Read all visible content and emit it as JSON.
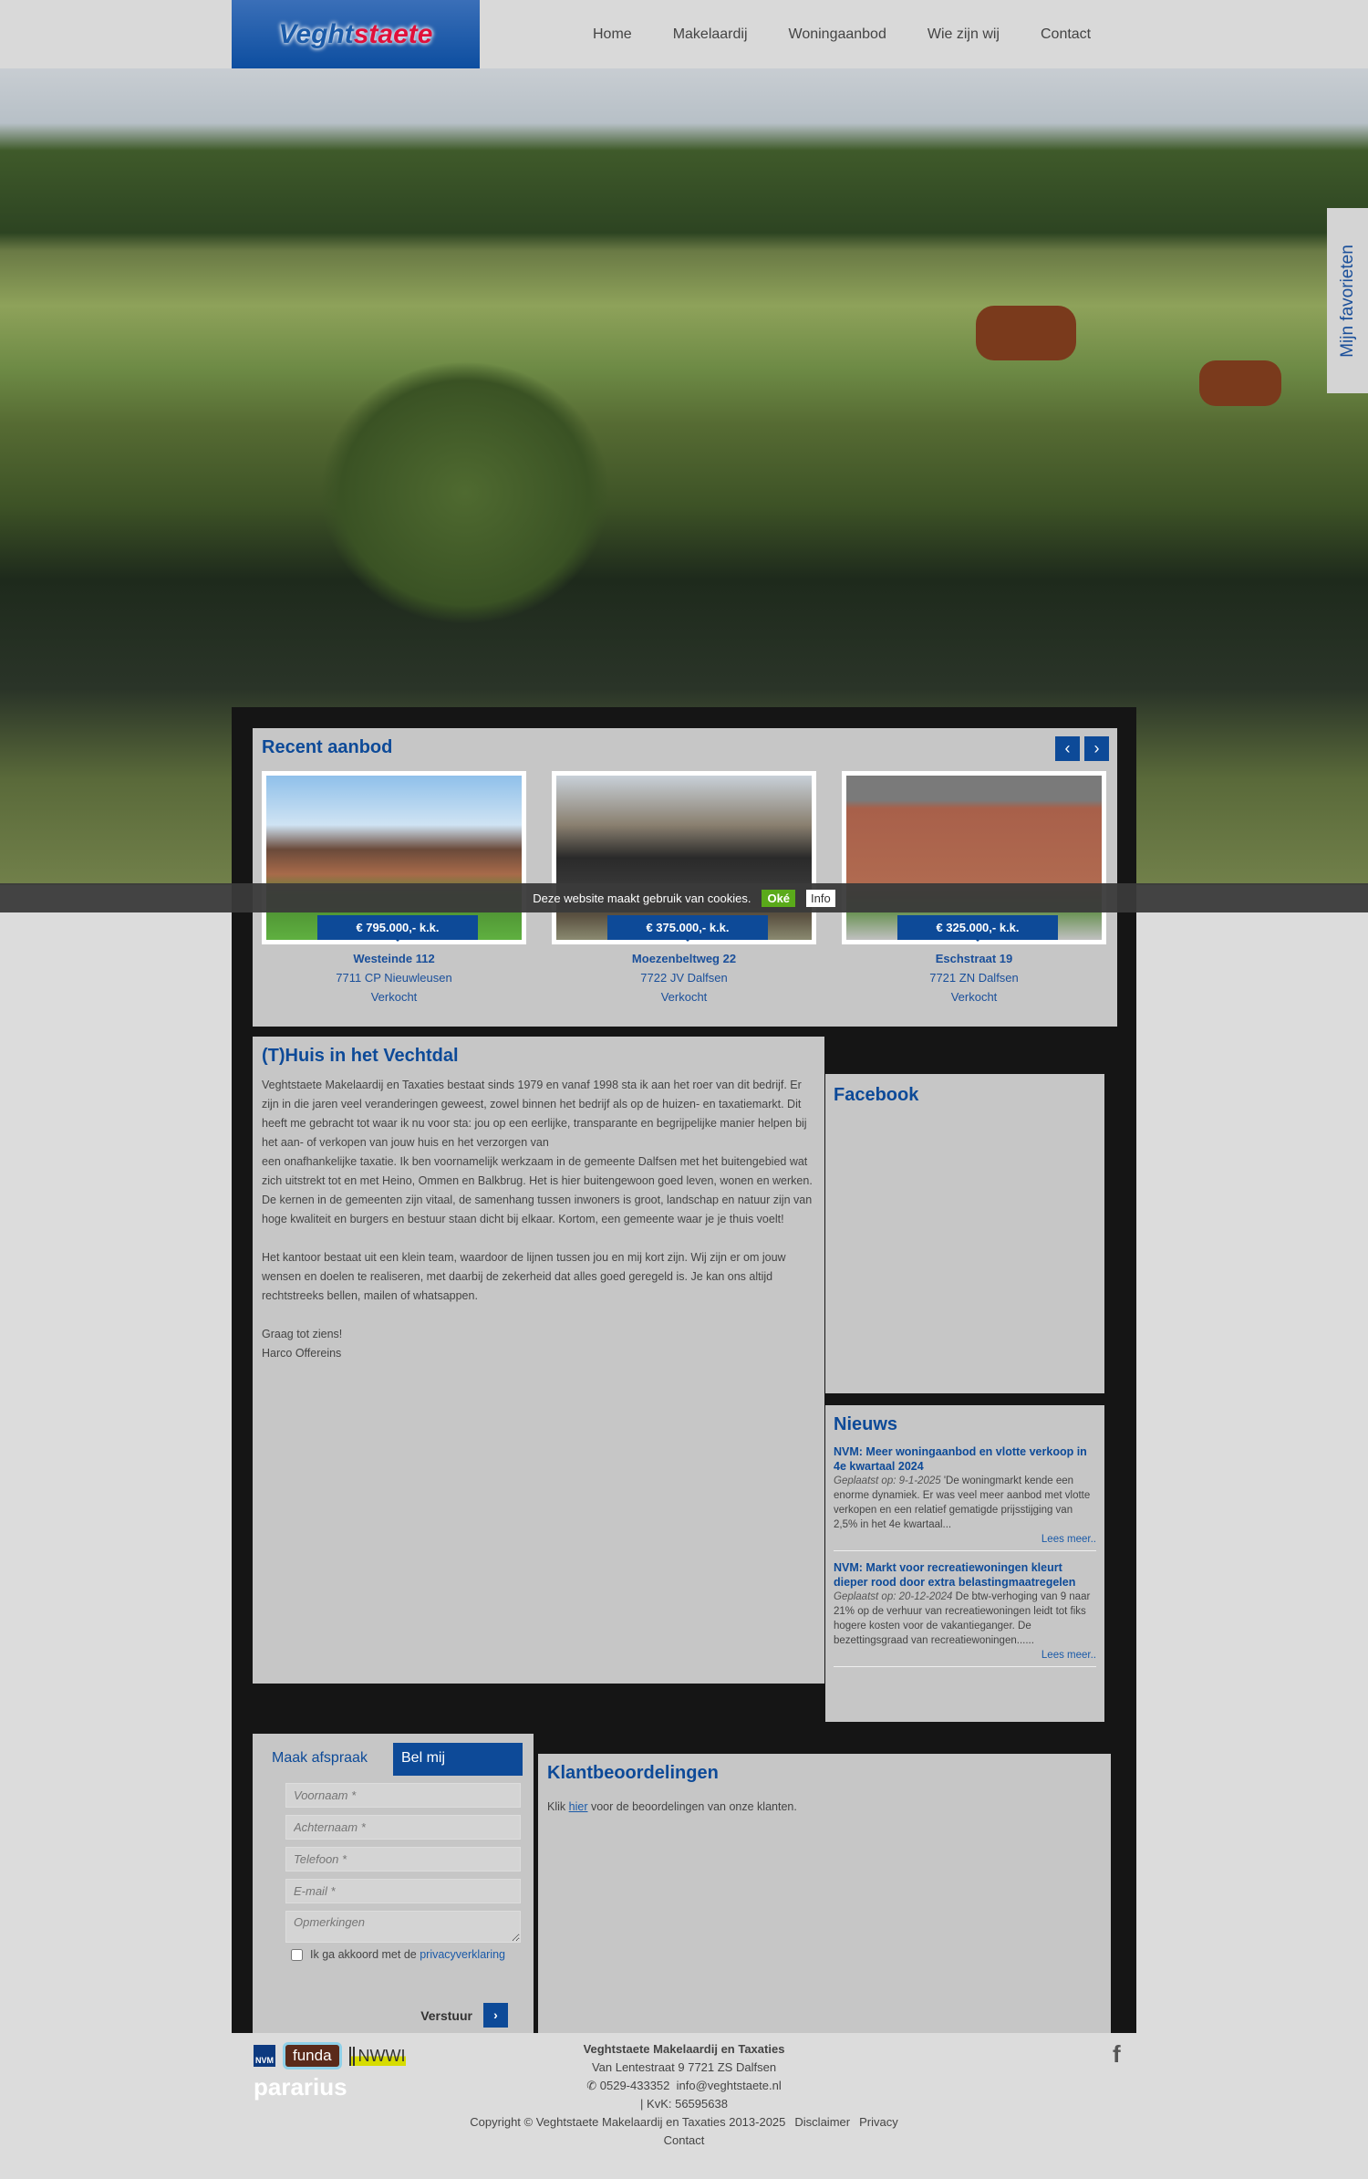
{
  "header": {
    "logo_main": "Veght",
    "logo_accent": "staete",
    "nav": [
      "Home",
      "Makelaardij",
      "Woningaanbod",
      "Wie zijn wij",
      "Contact"
    ]
  },
  "favorites_tab": "Mijn favorieten",
  "cookie": {
    "text": "Deze website maakt gebruik van cookies.",
    "ok": "Oké",
    "info": "Info"
  },
  "recent": {
    "title": "Recent aanbod",
    "prev": "‹",
    "next": "›",
    "items": [
      {
        "price": "€ 795.000,- k.k.",
        "street": "Westeinde 112",
        "city": "7711 CP Nieuwleusen",
        "status": "Verkocht"
      },
      {
        "price": "€ 375.000,- k.k.",
        "street": "Moezenbeltweg 22",
        "city": "7722 JV Dalfsen",
        "status": "Verkocht"
      },
      {
        "price": "€ 325.000,- k.k.",
        "street": "Eschstraat 19",
        "city": "7721 ZN Dalfsen",
        "status": "Verkocht"
      }
    ]
  },
  "main": {
    "title": "(T)Huis in het Vechtdal",
    "paragraphs": [
      "Veghtstaete Makelaardij en Taxaties bestaat sinds 1979 en vanaf 1998 sta ik aan het roer van dit bedrijf. Er zijn in die jaren veel veranderingen geweest, zowel binnen het bedrijf als op de huizen- en taxatiemarkt. Dit heeft me gebracht tot waar ik nu voor sta: jou op een eerlijke, transparante en begrijpelijke manier helpen bij het aan- of verkopen van jouw huis en het verzorgen van\neen onafhankelijke taxatie. Ik ben voornamelijk werkzaam in de gemeente Dalfsen met het buitengebied wat zich uitstrekt tot en met Heino, Ommen en Balkbrug. Het  is hier buitengewoon goed leven, wonen en werken. De kernen in de gemeenten zijn vitaal, de samenhang tussen inwoners is groot, landschap en natuur zijn van hoge kwaliteit en burgers en bestuur staan dicht bij elkaar. Kortom, een gemeente waar je je thuis voelt!",
      "Het kantoor bestaat uit een klein team, waardoor de lijnen tussen jou en mij kort zijn. Wij zijn er om jouw wensen en doelen te realiseren, met daarbij de zekerheid dat alles goed geregeld is. Je kan ons altijd rechtstreeks bellen, mailen of whatsappen.",
      "Graag tot ziens!\nHarco Offereins"
    ]
  },
  "facebook": {
    "title": "Facebook"
  },
  "news": {
    "title": "Nieuws",
    "items": [
      {
        "title": "NVM: Meer woningaanbod en vlotte verkoop in 4e kwartaal 2024",
        "date": "Geplaatst op: 9-1-2025",
        "text": " 'De woningmarkt kende een enorme dynamiek. Er was veel meer aanbod met vlotte verkopen en een relatief gematigde prijsstijging van 2,5% in het 4e kwartaal...",
        "more": "Lees meer.."
      },
      {
        "title": "NVM: Markt voor recreatiewoningen kleurt dieper rood door extra belastingmaatregelen",
        "date": "Geplaatst op: 20-12-2024",
        "text": " De btw-verhoging van 9 naar 21% op de verhuur van recreatiewoningen leidt tot fiks hogere kosten voor de vakantieganger. De bezettingsgraad van recreatiewoningen......",
        "more": "Lees meer.."
      }
    ]
  },
  "form": {
    "tab_appointment": "Maak afspraak",
    "tab_call": "Bel mij",
    "first_name": "Voornaam *",
    "last_name": "Achternaam *",
    "phone": "Telefoon *",
    "email": "E-mail *",
    "remarks": "Opmerkingen",
    "agree": "Ik ga akkoord met de",
    "privacy": "privacyverklaring",
    "submit": "Verstuur"
  },
  "reviews": {
    "title": "Klantbeoordelingen",
    "pre": "Klik",
    "link": "hier",
    "post": "voor de beoordelingen van onze klanten."
  },
  "footer": {
    "logos": [
      "NVM",
      "funda",
      "NWWI",
      "pararius"
    ],
    "company": "Veghtstaete Makelaardij en Taxaties",
    "address": "Van Lentestraat 9   7721 ZS Dalfsen",
    "phone": "0529-433352",
    "email": "info@veghtstaete.nl",
    "kvk": "| KvK: 56595638",
    "copyright": "Copyright © Veghtstaete Makelaardij en Taxaties 2013-2025",
    "links": [
      "Disclaimer",
      "Privacy",
      "Contact"
    ]
  },
  "colors": {
    "brand": "#0d4a98",
    "panel": "#c6c6c6",
    "dark": "#151515"
  }
}
